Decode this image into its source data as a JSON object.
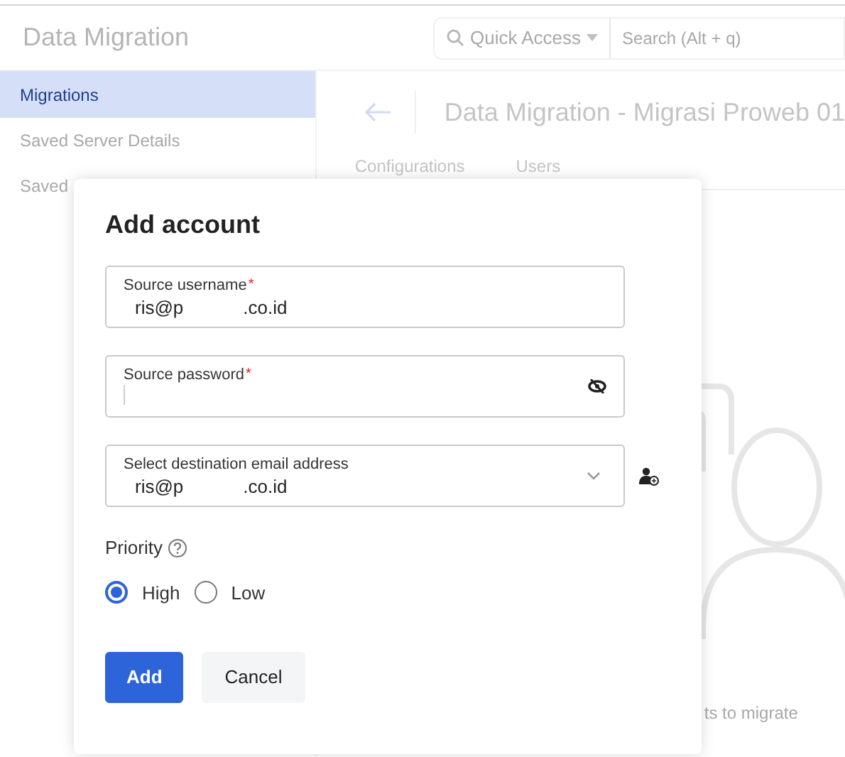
{
  "app": {
    "title": "Data Migration",
    "quick_access": "Quick Access",
    "search": {
      "placeholder": "Search (Alt + q)"
    }
  },
  "sidebar": {
    "items": [
      {
        "label": "Migrations",
        "selected": true
      },
      {
        "label": "Saved Server Details",
        "selected": false
      },
      {
        "label": "Saved",
        "selected": false
      }
    ]
  },
  "page": {
    "title": "Data Migration - Migrasi Proweb 01",
    "tabs": [
      {
        "label": "Configurations",
        "selected": false
      },
      {
        "label": "Users",
        "selected": false
      }
    ],
    "empty_text": "ts to migrate"
  },
  "dialog": {
    "title": "Add account",
    "required_mark": "*",
    "fields": [
      {
        "kind": "text",
        "label": "Source username",
        "required": true,
        "value_parts": [
          "ris@p",
          ".co.id"
        ]
      },
      {
        "kind": "password",
        "label": "Source password",
        "required": true
      },
      {
        "kind": "select",
        "label": "Select destination email address",
        "required": false,
        "value_parts": [
          "ris@p",
          ".co.id"
        ]
      }
    ],
    "priority": {
      "label": "Priority",
      "options": [
        {
          "label": "High",
          "selected": true
        },
        {
          "label": "Low",
          "selected": false
        }
      ]
    },
    "buttons": [
      {
        "kind": "primary",
        "label": "Add"
      },
      {
        "kind": "secondary",
        "label": "Cancel"
      }
    ]
  }
}
